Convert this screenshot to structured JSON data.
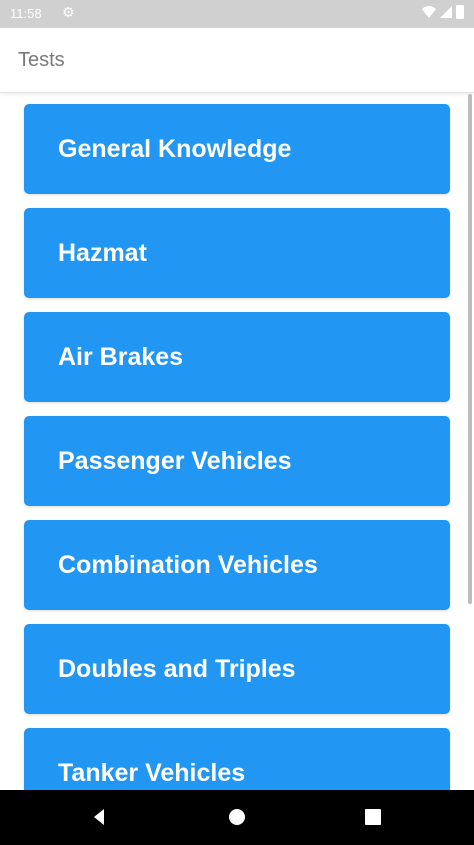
{
  "status_bar": {
    "time": "11:58",
    "icons": [
      "gear-icon",
      "wifi-icon",
      "signal-icon",
      "battery-icon"
    ]
  },
  "app_bar": {
    "title": "Tests"
  },
  "tests": [
    {
      "label": "General Knowledge"
    },
    {
      "label": "Hazmat"
    },
    {
      "label": "Air Brakes"
    },
    {
      "label": "Passenger Vehicles"
    },
    {
      "label": "Combination Vehicles"
    },
    {
      "label": "Doubles and Triples"
    },
    {
      "label": "Tanker Vehicles"
    }
  ],
  "nav_bar": {
    "icons": [
      "back-icon",
      "home-icon",
      "recents-icon"
    ]
  },
  "colors": {
    "accent": "#2196F3",
    "status_bar": "#D0D0D0",
    "nav_bar": "#000000"
  }
}
